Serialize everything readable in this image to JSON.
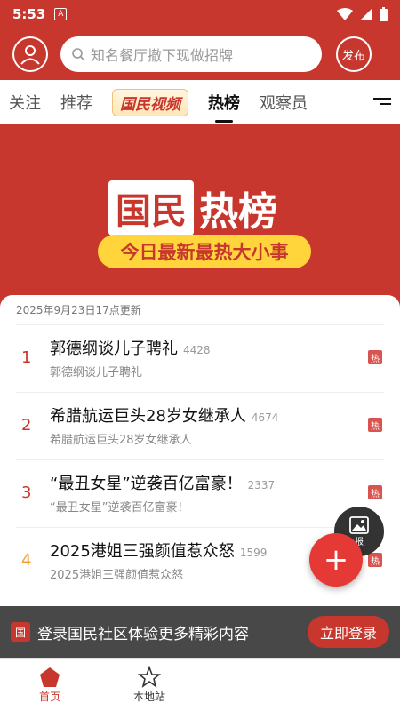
{
  "status": {
    "time": "5:53"
  },
  "header": {
    "search_placeholder": "知名餐厅撤下现做招牌",
    "publish_label": "发布"
  },
  "tabs": [
    {
      "label": "关注"
    },
    {
      "label": "推荐"
    },
    {
      "label": "国民视频"
    },
    {
      "label": "热榜"
    },
    {
      "label": "观察员"
    }
  ],
  "banner": {
    "title_box": "国民",
    "title_rest": "热榜",
    "subtitle": "今日最新最热大小事"
  },
  "list": {
    "updated": "2025年9月23日17点更新",
    "items": [
      {
        "rank": "1",
        "title": "郭德纲谈儿子聘礼",
        "count": "4428",
        "sub": "郭德纲谈儿子聘礼",
        "badge": "热"
      },
      {
        "rank": "2",
        "title": "希腊航运巨头28岁女继承人",
        "count": "4674",
        "sub": "希腊航运巨头28岁女继承人",
        "badge": "热"
      },
      {
        "rank": "3",
        "title": "“最丑女星”逆袭百亿富豪！",
        "count": "2337",
        "sub": "“最丑女星”逆袭百亿富豪！",
        "badge": "热"
      },
      {
        "rank": "4",
        "title": "2025港姐三强颜值惹众怒",
        "count": "1599",
        "sub": "2025港姐三强颜值惹众怒",
        "badge": "热"
      }
    ]
  },
  "fab": {
    "report_label": "报"
  },
  "login_bar": {
    "logo": "国",
    "text": "登录国民社区体验更多精彩内容",
    "button": "立即登录"
  },
  "bottom_nav": [
    {
      "label": "首页"
    },
    {
      "label": "本地站"
    }
  ],
  "colors": {
    "brand": "#c8372d",
    "accent_yellow": "#ffd53b"
  }
}
